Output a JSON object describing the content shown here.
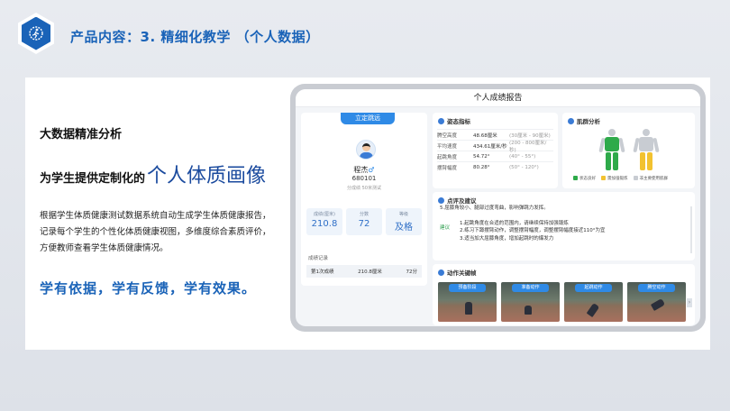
{
  "slide": {
    "title": "产品内容：3. 精细化教学 （个人数据）"
  },
  "left": {
    "heading": "大数据精准分析",
    "subheading_prefix": "为学生提供定制化的",
    "subheading_emphasis": "个人体质画像",
    "paragraph_lines": [
      "根据学生体质健康测试数据系统自动生成学生体质健康报告，",
      "记录每个学生的个性化体质健康视图，多维度综合素质评价，",
      "方便教师查看学生体质健康情况。"
    ],
    "slogan": "学有依据，学有反馈，学有效果。"
  },
  "report": {
    "title": "个人成绩报告",
    "profile": {
      "badge": "立定跳远",
      "name": "程杰",
      "gender_icon": "♂",
      "id": "680101",
      "meta": "分成绩 50米测试",
      "stats": [
        {
          "label": "成绩(厘米)",
          "value": "210.8"
        },
        {
          "label": "分数",
          "value": "72"
        },
        {
          "label": "等级",
          "value": "及格"
        }
      ],
      "record_title": "成绩记录",
      "record": {
        "label": "第1次成绩",
        "value": "210.8厘米",
        "score": "72分"
      }
    },
    "posture": {
      "title": "姿态指标",
      "rows": [
        {
          "k": "腾空高度",
          "v": "48.68厘米",
          "r": "(30厘米 - 90厘米)"
        },
        {
          "k": "平均速度",
          "v": "434.61厘米/秒",
          "r": "(200 - 800厘米/秒)"
        },
        {
          "k": "起跳角度",
          "v": "54.72°",
          "r": "(40° - 55°)"
        },
        {
          "k": "摆臂幅度",
          "v": "80.28°",
          "r": "(50° - 120°)"
        }
      ]
    },
    "muscle": {
      "title": "肌群分析",
      "legend": [
        "状态良好",
        "需加强锻炼",
        "非主要使用肌群"
      ],
      "colors": {
        "good": "#2eaa4a",
        "weak": "#f2c230",
        "unused": "#c8ccd2"
      }
    },
    "comment": {
      "title": "点评及建议",
      "line0": "5.屈膝角较小、腿部过度弯曲，影响弹跳力发挥。",
      "tag": "建议",
      "lines": [
        "1.起跳角度在合适的范围内，请继续保持加强锻炼",
        "2.练习下蹲摆臂动作，调整摆臂幅度，调整摆臂幅度接近110°为宜",
        "3.适当加大屈膝角度，增加起跳时的爆发力"
      ]
    },
    "keyframes": {
      "title": "动作关键帧",
      "captions": [
        "预备阶段",
        "准备动作",
        "起跳动作",
        "腾空动作"
      ],
      "arrow": "›"
    }
  }
}
